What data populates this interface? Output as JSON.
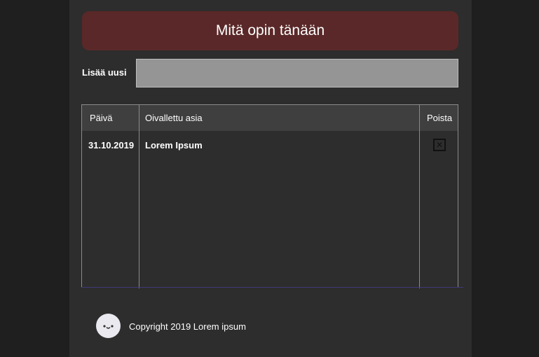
{
  "header": {
    "title": "Mitä opin tänään"
  },
  "add_form": {
    "label": "Lisää uusi",
    "value": "",
    "placeholder": ""
  },
  "table": {
    "columns": [
      "Päivä",
      "Oivallettu asia",
      "Poista"
    ],
    "rows": [
      {
        "date": "31.10.2019",
        "item": "Lorem Ipsum",
        "delete_icon": "close-icon"
      }
    ]
  },
  "footer": {
    "text": "Copyright 2019 Lorem ipsum",
    "avatar_icon": "smiley-face-icon"
  },
  "colors": {
    "background": "#1f1f1f",
    "panel": "#2d2d2d",
    "title_bar": "#5a2828",
    "input": "#959595",
    "table_header": "#3f3f3f"
  }
}
